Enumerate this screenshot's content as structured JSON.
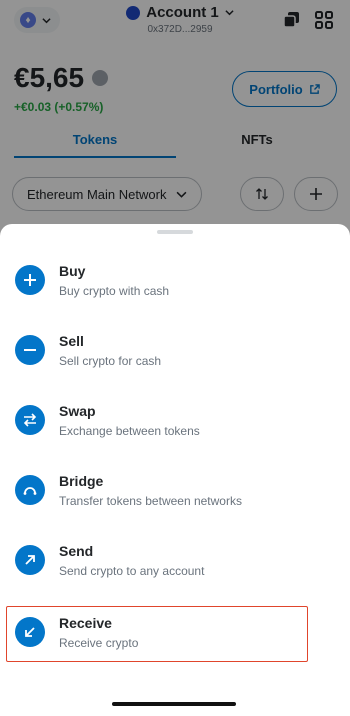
{
  "header": {
    "account_name": "Account 1",
    "account_address": "0x372D...2959"
  },
  "wallet": {
    "balance": "€5,65",
    "delta": "+€0.03 (+0.57%)",
    "portfolio_label": "Portfolio"
  },
  "tabs": [
    {
      "label": "Tokens",
      "active": true
    },
    {
      "label": "NFTs",
      "active": false
    }
  ],
  "network": {
    "selected": "Ethereum Main Network"
  },
  "sheet": {
    "actions": [
      {
        "title": "Buy",
        "subtitle": "Buy crypto with cash",
        "icon": "plus-icon"
      },
      {
        "title": "Sell",
        "subtitle": "Sell crypto for cash",
        "icon": "minus-icon"
      },
      {
        "title": "Swap",
        "subtitle": "Exchange between tokens",
        "icon": "swap-icon"
      },
      {
        "title": "Bridge",
        "subtitle": "Transfer tokens between networks",
        "icon": "bridge-icon"
      },
      {
        "title": "Send",
        "subtitle": "Send crypto to any account",
        "icon": "arrow-up-right-icon"
      },
      {
        "title": "Receive",
        "subtitle": "Receive crypto",
        "icon": "arrow-down-left-icon"
      }
    ]
  },
  "colors": {
    "accent": "#0376c9",
    "positive": "#28a745",
    "highlight": "#e0452c",
    "scrim": "rgba(0,0,0,0.42)"
  }
}
